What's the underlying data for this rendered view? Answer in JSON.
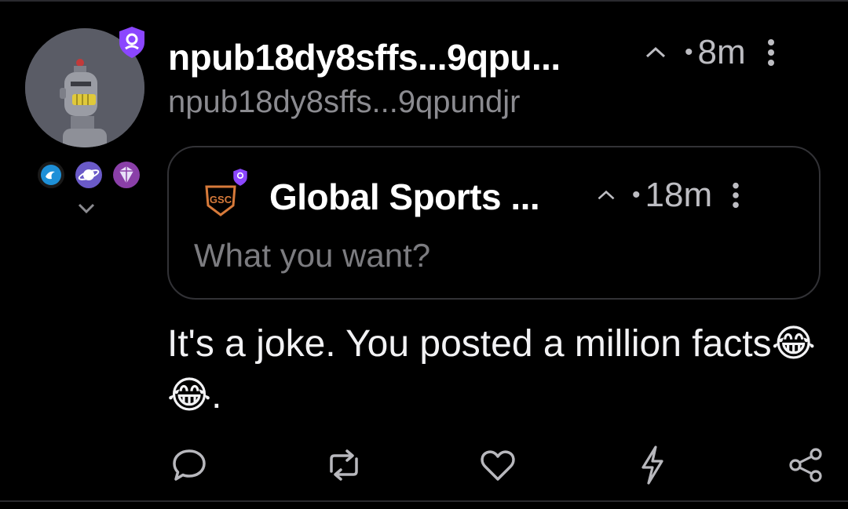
{
  "post": {
    "author_name": "npub18dy8sffs...9qpu...",
    "author_handle": "npub18dy8sffs...9qpundjr",
    "time": "8m",
    "separator": "•",
    "content": "It's a joke. You posted a million facts😂😂."
  },
  "quoted": {
    "author_name": "Global Sports ...",
    "time": "18m",
    "separator": "•",
    "content": "What you want?",
    "logo_text": "GSC"
  },
  "colors": {
    "verify_badge": "#8b46ff",
    "background": "#000000",
    "muted_text": "#8b8b90",
    "icon_gray": "#b8b8bd"
  },
  "icons": [
    "verified-badge-icon",
    "wave-badge-icon",
    "planet-badge-icon",
    "diamond-badge-icon",
    "chevron-down-icon",
    "chevron-up-icon",
    "more-vertical-icon",
    "reply-icon",
    "repost-icon",
    "like-icon",
    "zap-icon",
    "share-icon"
  ]
}
